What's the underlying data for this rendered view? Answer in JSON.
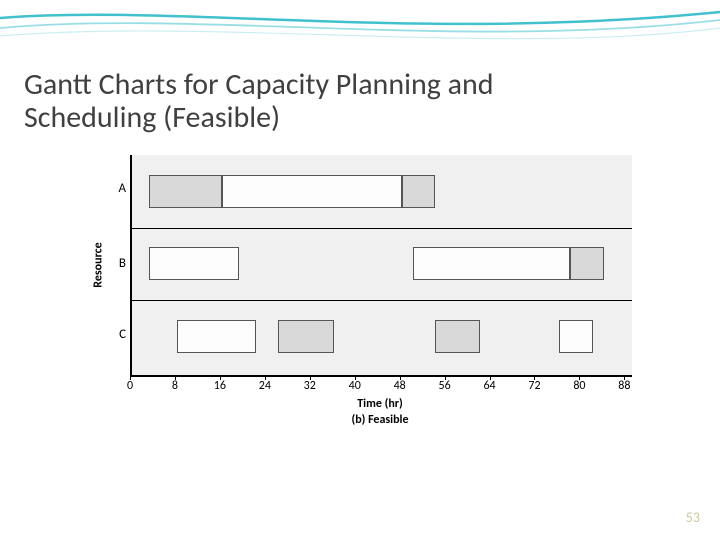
{
  "slide": {
    "title": "Gantt Charts for Capacity Planning and Scheduling (Feasible)",
    "page_number": "53"
  },
  "chart_data": {
    "type": "bar",
    "orientation": "horizontal-gantt",
    "xlabel": "Time (hr)",
    "ylabel": "Resource",
    "subtitle": "(b) Feasible",
    "xlim": [
      0,
      89
    ],
    "xticks": [
      0,
      8,
      16,
      24,
      32,
      40,
      48,
      56,
      64,
      72,
      80,
      88
    ],
    "categories": [
      "A",
      "B",
      "C"
    ],
    "tasks": [
      {
        "resource": "A",
        "start": 3,
        "end": 16,
        "shade": "dark"
      },
      {
        "resource": "A",
        "start": 16,
        "end": 48,
        "shade": "light"
      },
      {
        "resource": "A",
        "start": 48,
        "end": 54,
        "shade": "dark"
      },
      {
        "resource": "B",
        "start": 3,
        "end": 19,
        "shade": "light"
      },
      {
        "resource": "B",
        "start": 50,
        "end": 78,
        "shade": "light"
      },
      {
        "resource": "B",
        "start": 78,
        "end": 84,
        "shade": "dark"
      },
      {
        "resource": "C",
        "start": 8,
        "end": 22,
        "shade": "light"
      },
      {
        "resource": "C",
        "start": 26,
        "end": 36,
        "shade": "dark"
      },
      {
        "resource": "C",
        "start": 54,
        "end": 62,
        "shade": "dark"
      },
      {
        "resource": "C",
        "start": 76,
        "end": 82,
        "shade": "light"
      }
    ]
  },
  "colors": {
    "swoosh": "#1fb6c4"
  }
}
